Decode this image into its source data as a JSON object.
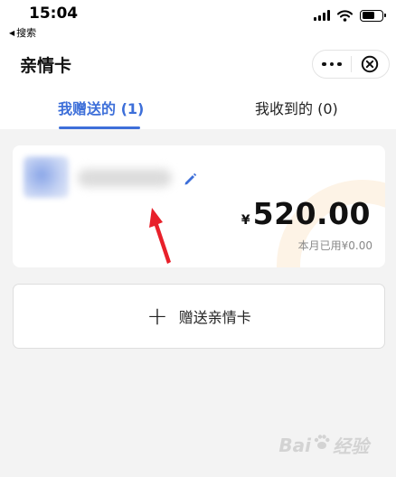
{
  "status_bar": {
    "time": "15:04",
    "back_app": "搜索",
    "icons": [
      "signal-icon",
      "wifi-icon",
      "battery-icon"
    ]
  },
  "nav": {
    "title": "亲情卡",
    "more_icon": "more-dots-icon",
    "close_icon": "close-circle-icon"
  },
  "tabs": [
    {
      "label": "我赠送的 (1)",
      "active": true
    },
    {
      "label": "我收到的 (0)",
      "active": false
    }
  ],
  "card": {
    "currency": "¥",
    "amount": "520.00",
    "usage": "本月已用¥0.00",
    "edit_icon": "pencil-icon"
  },
  "send_button": {
    "label": "赠送亲情卡",
    "icon": "plus-icon"
  },
  "watermark": {
    "text_left": "Bai",
    "text_right": "经验"
  },
  "colors": {
    "accent": "#3d6fd9",
    "arrow": "#e8202a",
    "background": "#f3f3f3"
  }
}
